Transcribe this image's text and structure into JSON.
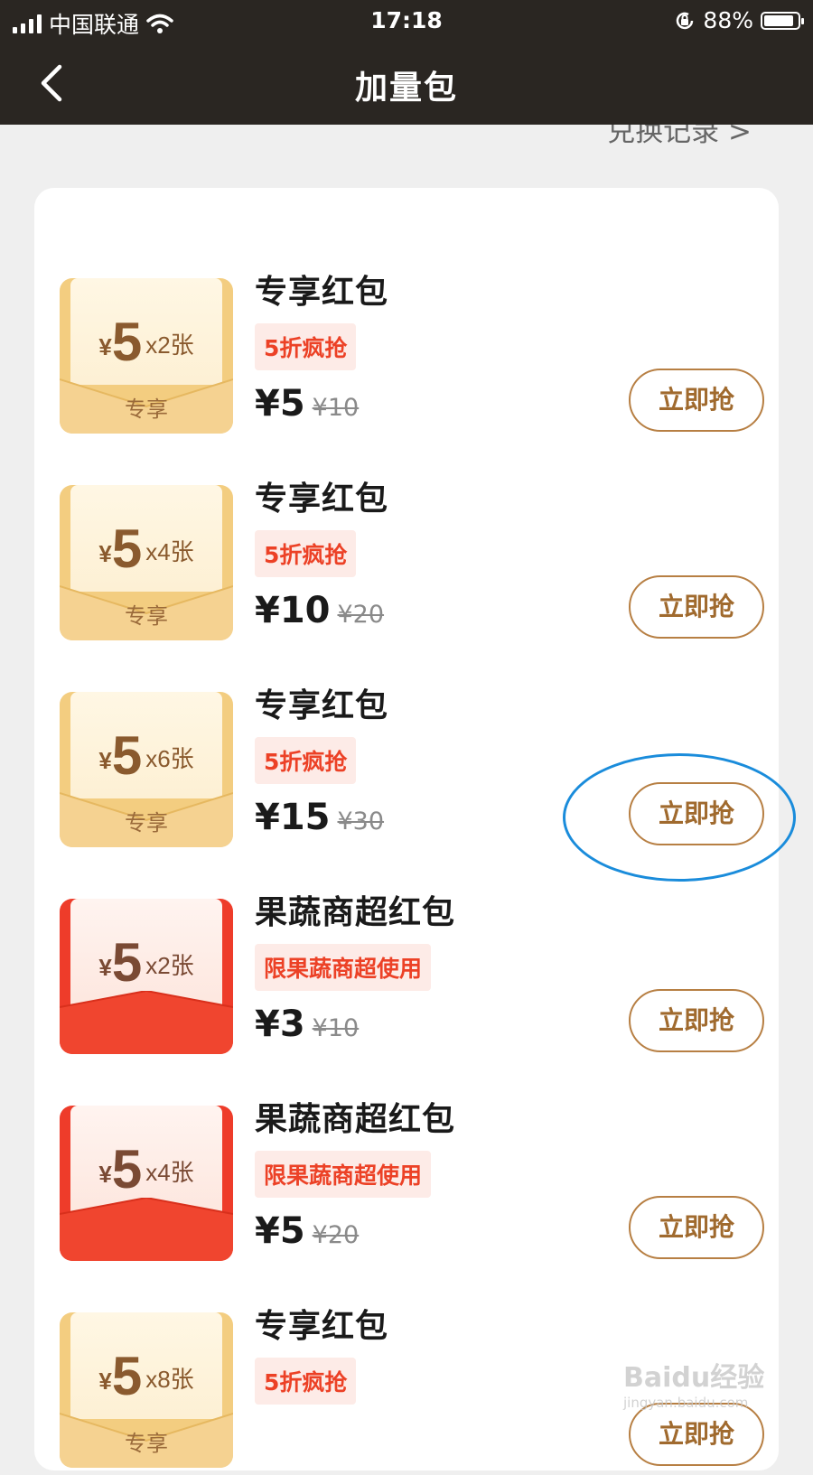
{
  "status_bar": {
    "carrier": "中国联通",
    "time": "17:18",
    "battery": "88%",
    "battery_level": 0.88
  },
  "nav": {
    "title": "加量包",
    "history_link": "兑换记录 >"
  },
  "items": [
    {
      "theme": "gold",
      "packet_amount": "5",
      "packet_count": "x2张",
      "packet_tag": "专享",
      "name": "专享红包",
      "badge": "5折疯抢",
      "price": "¥5",
      "original_price": "¥10",
      "button": "立即抢"
    },
    {
      "theme": "gold",
      "packet_amount": "5",
      "packet_count": "x4张",
      "packet_tag": "专享",
      "name": "专享红包",
      "badge": "5折疯抢",
      "price": "¥10",
      "original_price": "¥20",
      "button": "立即抢"
    },
    {
      "theme": "gold",
      "packet_amount": "5",
      "packet_count": "x6张",
      "packet_tag": "专享",
      "name": "专享红包",
      "badge": "5折疯抢",
      "price": "¥15",
      "original_price": "¥30",
      "button": "立即抢"
    },
    {
      "theme": "red",
      "packet_amount": "5",
      "packet_count": "x2张",
      "packet_tag": "",
      "name": "果蔬商超红包",
      "badge": "限果蔬商超使用",
      "price": "¥3",
      "original_price": "¥10",
      "button": "立即抢"
    },
    {
      "theme": "red",
      "packet_amount": "5",
      "packet_count": "x4张",
      "packet_tag": "",
      "name": "果蔬商超红包",
      "badge": "限果蔬商超使用",
      "price": "¥5",
      "original_price": "¥20",
      "button": "立即抢"
    },
    {
      "theme": "gold",
      "packet_amount": "5",
      "packet_count": "x8张",
      "packet_tag": "专享",
      "name": "专享红包",
      "badge": "5折疯抢",
      "price": "",
      "original_price": "",
      "button": "立即抢"
    }
  ],
  "currency_symbol": "¥",
  "watermark": {
    "text": "Baidu经验",
    "sub": "jingyan.baidu.com"
  }
}
